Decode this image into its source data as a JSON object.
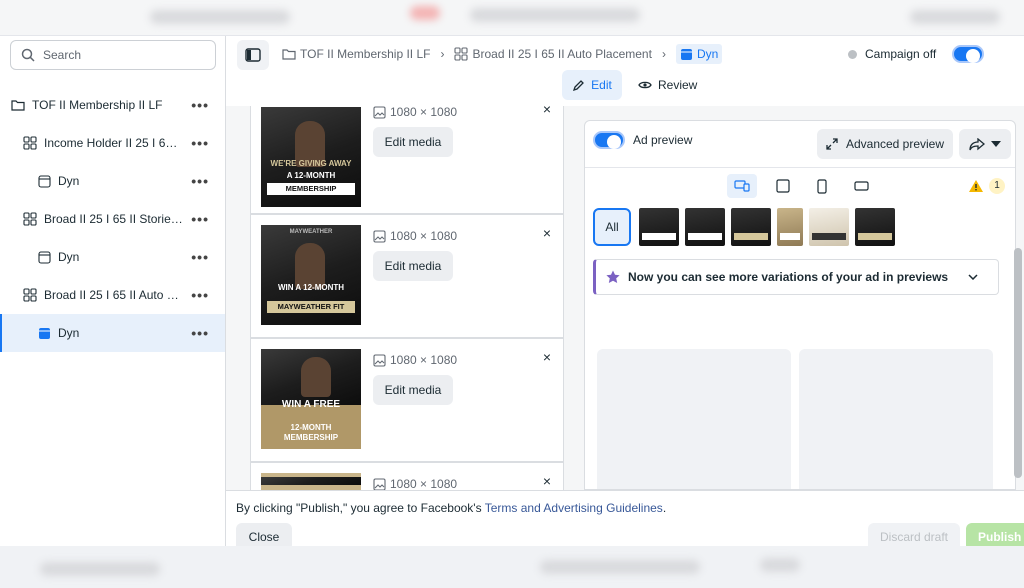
{
  "search": {
    "placeholder": "Search"
  },
  "sidebar": {
    "items": [
      {
        "label": "TOF II Membership II LF",
        "type": "campaign"
      },
      {
        "label": "Income Holder II 25 I 65 I...",
        "type": "adset"
      },
      {
        "label": "Dyn",
        "type": "ad"
      },
      {
        "label": "Broad II 25 I 65 II Stories ...",
        "type": "adset"
      },
      {
        "label": "Dyn",
        "type": "ad"
      },
      {
        "label": "Broad II 25 I 65 II Auto Pl...",
        "type": "adset"
      },
      {
        "label": "Dyn",
        "type": "ad",
        "selected": true
      }
    ],
    "more": "•••"
  },
  "breadcrumb": {
    "items": [
      "TOF II Membership II LF",
      "Broad II 25 I 65 II Auto Placement",
      "Dyn"
    ],
    "separator": "›"
  },
  "header": {
    "campaign_status": "Campaign off",
    "edit_label": "Edit",
    "review_label": "Review"
  },
  "media": {
    "cards": [
      {
        "dims": "1080 × 1080",
        "edit": "Edit media",
        "cap1": "WE'RE GIVING AWAY",
        "cap2": "A 12-MONTH",
        "band": "MEMBERSHIP"
      },
      {
        "dims": "1080 × 1080",
        "edit": "Edit media",
        "cap1": "MAYWEATHER",
        "cap2": "WIN A 12-MONTH",
        "band": "MAYWEATHER FIT"
      },
      {
        "dims": "1080 × 1080",
        "edit": "Edit media",
        "cap1": "WIN A FREE",
        "cap2": "12-MONTH",
        "band": "MEMBERSHIP"
      },
      {
        "dims": "1080 × 1080",
        "edit": "",
        "cap1": "",
        "cap2": "",
        "band": ""
      }
    ],
    "close": "×"
  },
  "preview": {
    "ad_preview_label": "Ad preview",
    "advanced_label": "Advanced preview",
    "warning_count": "1",
    "all_label": "All",
    "notice": "Now you can see more variations of your ad in previews"
  },
  "footer": {
    "terms_prefix": "By clicking \"Publish,\" you agree to Facebook's ",
    "terms_link": "Terms and Advertising Guidelines",
    "terms_suffix": ".",
    "close_label": "Close",
    "discard_label": "Discard draft",
    "publish_label": "Publish"
  },
  "colors": {
    "accent": "#1877f2",
    "publish": "#b7e4a5",
    "notice_accent": "#7b61c2"
  }
}
